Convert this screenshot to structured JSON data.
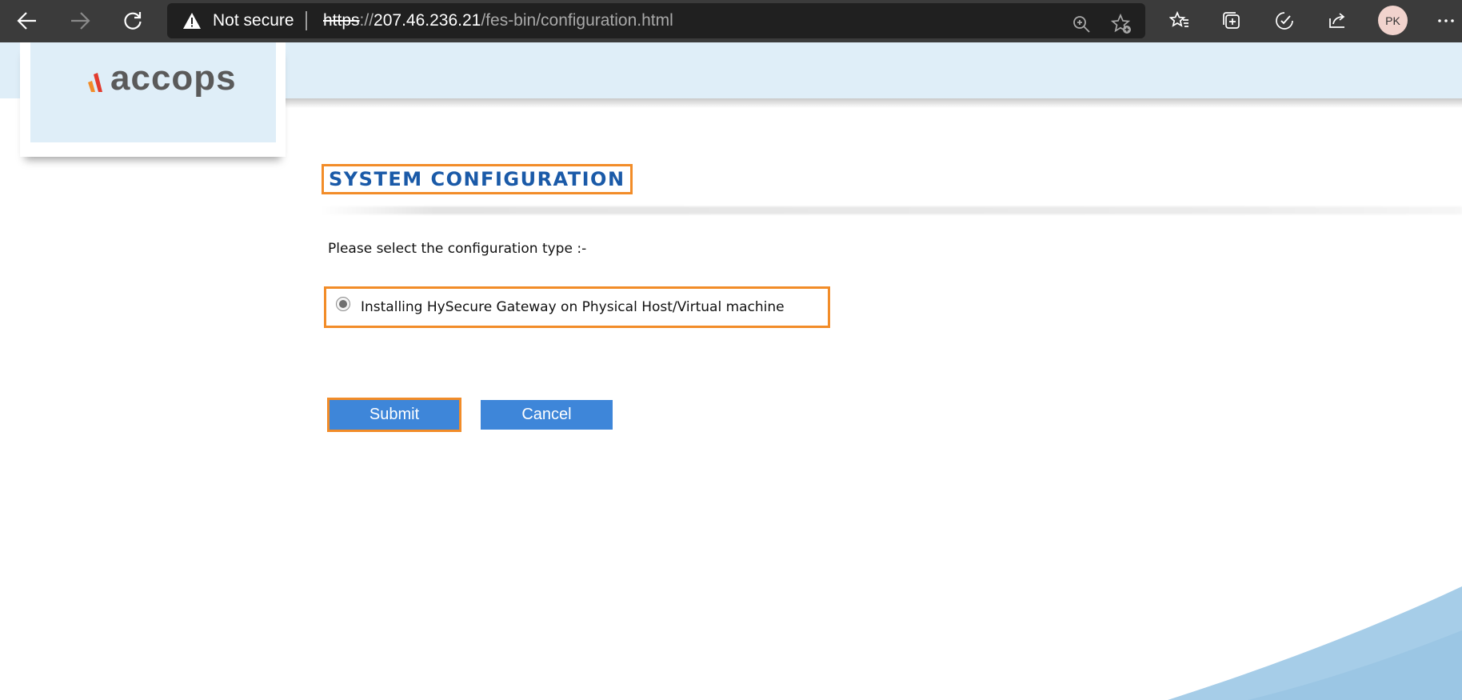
{
  "browser": {
    "security_label": "Not secure",
    "url_scheme": "https",
    "url_host": "207.46.236.21",
    "url_path": "/fes-bin/configuration.html",
    "profile_initials": "PK"
  },
  "header": {
    "logo_text": "accops"
  },
  "main": {
    "title": "SYSTEM CONFIGURATION",
    "prompt": "Please select the configuration type :-",
    "option_label": "Installing HySecure Gateway on Physical Host/Virtual machine",
    "submit_label": "Submit",
    "cancel_label": "Cancel"
  },
  "colors": {
    "accent": "#3e86d9",
    "title": "#1a5aa8",
    "highlight": "#f28c28",
    "band": "#dfeef8"
  }
}
